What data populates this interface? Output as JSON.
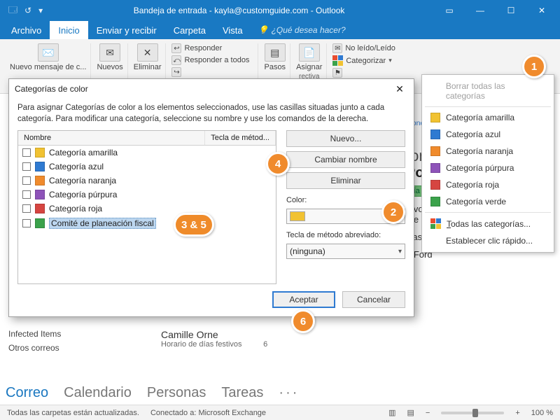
{
  "titlebar": {
    "title": "Bandeja de entrada - kayla@customguide.com - Outlook"
  },
  "tabs": {
    "file": "Archivo",
    "home": "Inicio",
    "sendreceive": "Enviar y recibir",
    "folder": "Carpeta",
    "view": "Vista",
    "tellme": "¿Qué desea hacer?"
  },
  "ribbon": {
    "new_message": "Nuevo mensaje de c...",
    "new_items": "Nuevos",
    "delete": "Eliminar",
    "reply": "Responder",
    "reply_all": "Responder a todos",
    "steps": "Pasos",
    "assign": "Asignar",
    "rectiva": "rectiva",
    "unread": "No leído/Leído",
    "categorize": "Categorizar"
  },
  "catmenu": {
    "clear": "Borrar todas las categorías",
    "items": [
      {
        "label": "Categoría amarilla",
        "color": "#f1c232"
      },
      {
        "label": "Categoría azul",
        "color": "#2f7ad1"
      },
      {
        "label": "Categoría naranja",
        "color": "#f08b2d"
      },
      {
        "label": "Categoría púrpura",
        "color": "#8e53b9"
      },
      {
        "label": "Categoría roja",
        "color": "#d64541"
      },
      {
        "label": "Categoría verde",
        "color": "#3ba24b"
      }
    ],
    "all": "Todas las categorías...",
    "quickclick": "Establecer clic rápido..."
  },
  "dialog": {
    "title": "Categorías de color",
    "instructions": "Para asignar Categorías de color a los elementos seleccionados, use las casillas situadas junto a cada categoría. Para modificar una categoría, seleccione su nombre y use los comandos de la derecha.",
    "col_name": "Nombre",
    "col_shortcut": "Tecla de métod...",
    "rows": [
      {
        "label": "Categoría amarilla",
        "color": "#f1c232"
      },
      {
        "label": "Categoría azul",
        "color": "#2f7ad1"
      },
      {
        "label": "Categoría naranja",
        "color": "#f08b2d"
      },
      {
        "label": "Categoría púrpura",
        "color": "#8e53b9"
      },
      {
        "label": "Categoría roja",
        "color": "#d64541"
      },
      {
        "label": "Comité de planeación fiscal",
        "color": "#3ba24b",
        "selected": true
      }
    ],
    "new_btn": "Nuevo...",
    "rename_btn": "Cambiar nombre",
    "delete_btn": "Eliminar",
    "color_label": "Color:",
    "shortcut_label": "Tecla de método abreviado:",
    "shortcut_value": "(ninguna)",
    "ok": "Aceptar",
    "cancel": "Cancelar"
  },
  "readpane": {
    "sender_frag": "Ion",
    "subject_frag": "Pol",
    "cat_tag": "ría verde",
    "body1": "favor revisa la política actualizada y",
    "body2": "me saber lo que piensas.",
    "thanks": "cias!",
    "name": "a Ford",
    "responder": "sponder"
  },
  "leftnav": {
    "infected": "Infected Items",
    "other": "Otros correos"
  },
  "msgfrag": {
    "name": "Camille Orne",
    "subject": "Horario de días festivos",
    "time": "6"
  },
  "peek": {
    "mail": "Correo",
    "calendar": "Calendario",
    "people": "Personas",
    "tasks": "Tareas",
    "more": "···"
  },
  "status": {
    "allfolders": "Todas las carpetas están actualizadas.",
    "connected": "Conectado a: Microsoft Exchange",
    "zoom": "100 %"
  },
  "callouts": {
    "c1": "1",
    "c2": "2",
    "c35": "3 & 5",
    "c4": "4",
    "c6": "6"
  }
}
